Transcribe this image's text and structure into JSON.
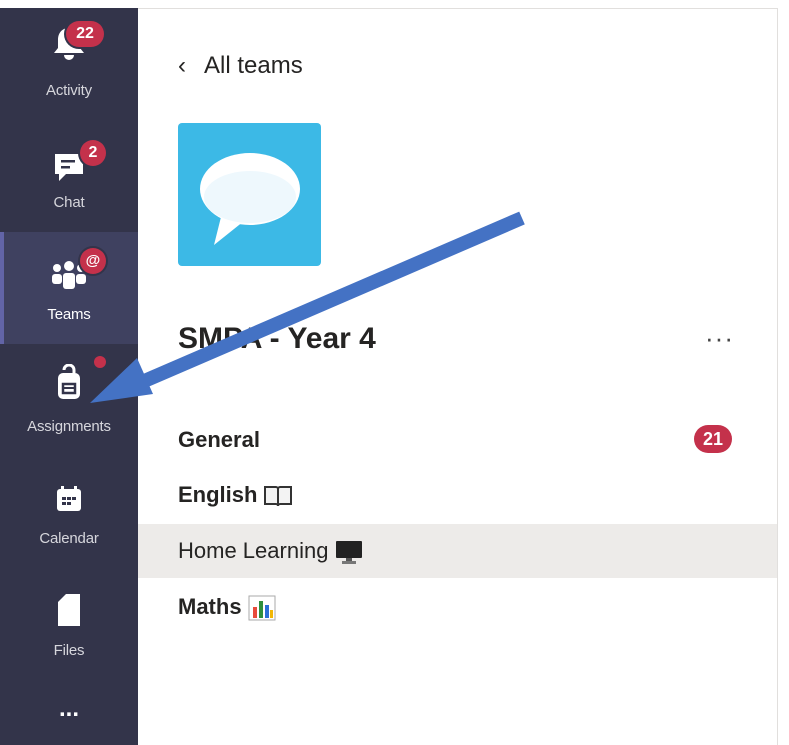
{
  "rail": {
    "items": [
      {
        "label": "Activity",
        "badge": "22"
      },
      {
        "label": "Chat",
        "badge": "2"
      },
      {
        "label": "Teams",
        "badge": "@"
      },
      {
        "label": "Assignments"
      },
      {
        "label": "Calendar"
      },
      {
        "label": "Files"
      }
    ],
    "more": "..."
  },
  "header": {
    "back_label": "All teams"
  },
  "team": {
    "name": "SMPA - Year 4",
    "more": "···"
  },
  "channels": [
    {
      "name": "General",
      "unread": "21",
      "bold": true
    },
    {
      "name": "English",
      "icon": "book-icon",
      "bold": true
    },
    {
      "name": "Home Learning",
      "icon": "monitor-icon",
      "selected": true
    },
    {
      "name": "Maths",
      "icon": "bar-chart-icon",
      "bold": true
    }
  ],
  "annotation": {
    "arrow_color": "#4472c4",
    "points_to": "Assignments"
  },
  "colors": {
    "rail_bg": "#33344a",
    "badge": "#c4314b",
    "team_tile": "#3cb9e6"
  }
}
